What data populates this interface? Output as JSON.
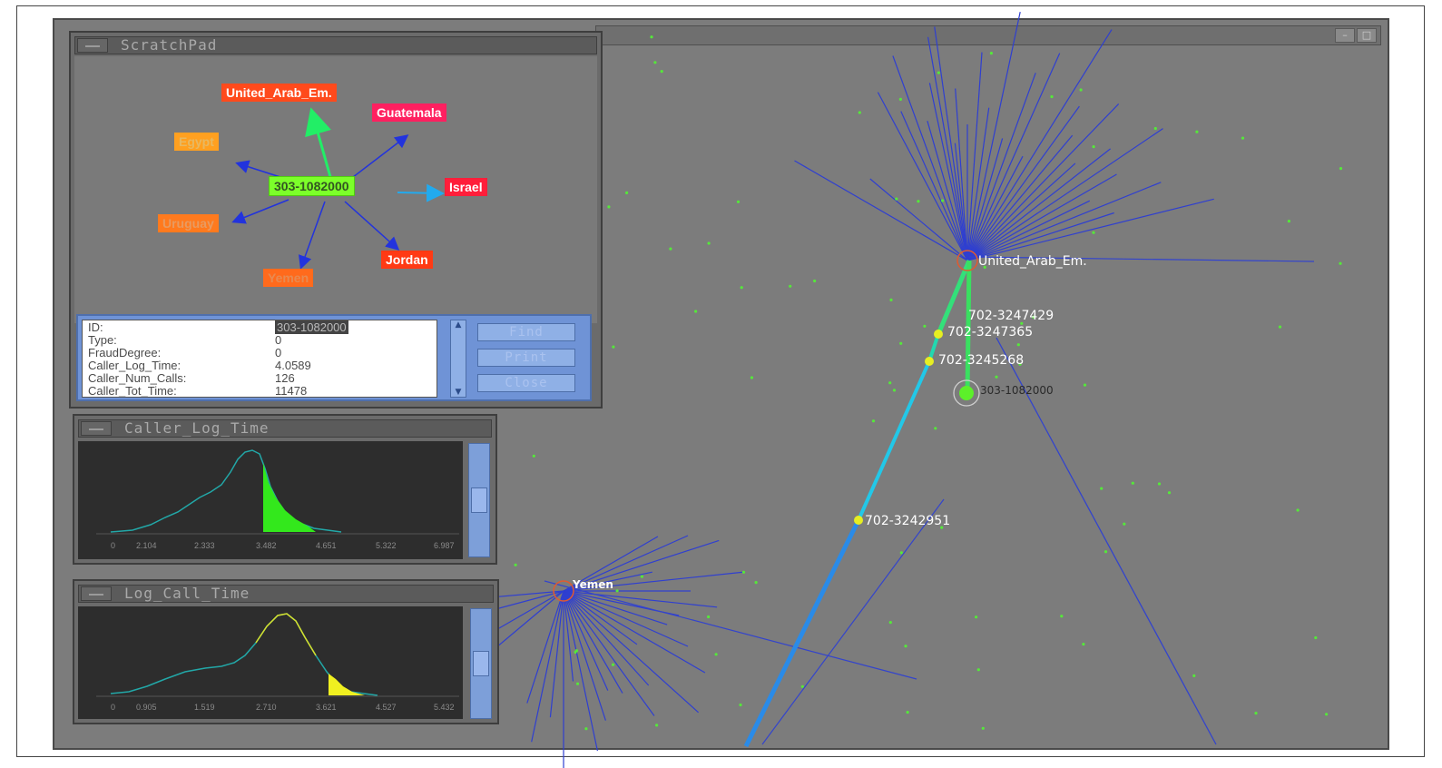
{
  "main_window": {
    "minimize_glyph": "–",
    "maximize_glyph": "□"
  },
  "graph": {
    "hub_uae_label": "United_Arab_Em.",
    "hub_yemen_label": "Yemen",
    "focus_node_label": "303-1082000",
    "path_labels": [
      "702-3247429",
      "702-3247365",
      "702-3245268",
      "702-3242951"
    ]
  },
  "scratchpad": {
    "title": "ScratchPad",
    "center_node": "303-1082000",
    "neighbors": [
      {
        "label": "United_Arab_Em.",
        "color": "#ff4a1c"
      },
      {
        "label": "Guatemala",
        "color": "#ff2060"
      },
      {
        "label": "Egypt",
        "color": "#ffa020"
      },
      {
        "label": "Israel",
        "color": "#ff1e3a"
      },
      {
        "label": "Uruguay",
        "color": "#ff7a1e"
      },
      {
        "label": "Jordan",
        "color": "#ff3a14"
      },
      {
        "label": "Yemen",
        "color": "#ff6a1c"
      }
    ],
    "center_color": "#7cff2a",
    "info_rows": [
      {
        "key": "ID:",
        "value": "303-1082000"
      },
      {
        "key": "Type:",
        "value": "0"
      },
      {
        "key": "FraudDegree:",
        "value": "0"
      },
      {
        "key": "Caller_Log_Time:",
        "value": "4.0589"
      },
      {
        "key": "Caller_Num_Calls:",
        "value": "126"
      },
      {
        "key": "Caller_Tot_Time:",
        "value": "11478"
      }
    ],
    "buttons": {
      "find": "Find",
      "print": "Print",
      "close": "Close"
    }
  },
  "hist_caller": {
    "title": "Caller_Log_Time",
    "ticks": [
      "0",
      "2.104",
      "2.333",
      "3.482",
      "4.651",
      "5.322",
      "6.987"
    ],
    "highlight_color": "#33e81c"
  },
  "hist_call": {
    "title": "Log_Call_Time",
    "ticks": [
      "0",
      "0.905",
      "1.519",
      "2.710",
      "3.621",
      "4.527",
      "5.432"
    ],
    "highlight_color": "#f0f020"
  }
}
